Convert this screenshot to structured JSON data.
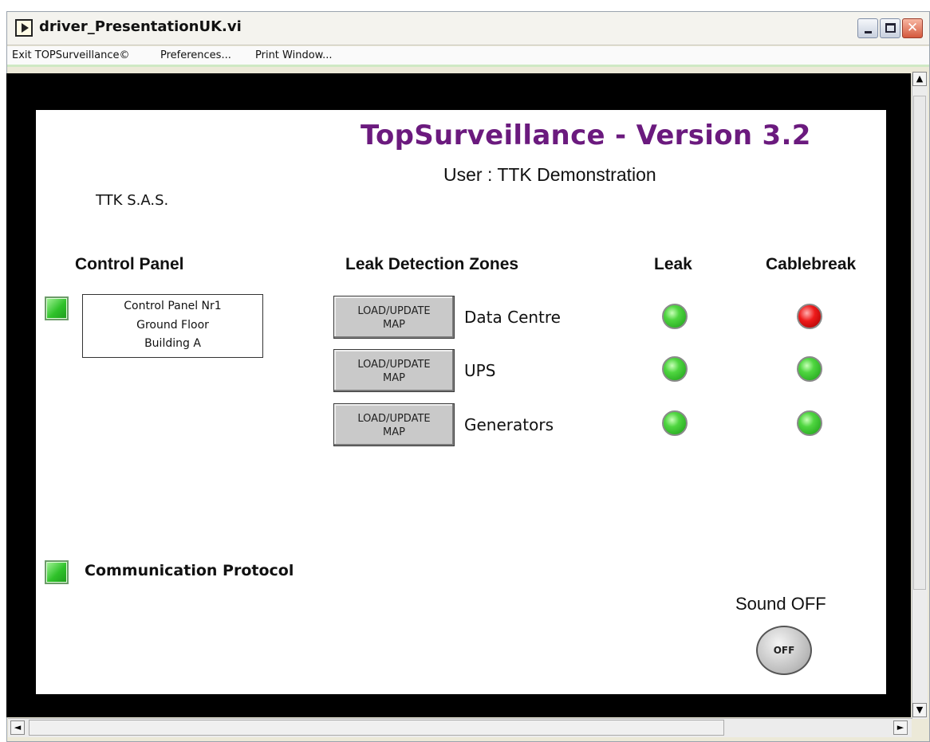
{
  "window": {
    "title": "driver_PresentationUK.vi"
  },
  "menu": {
    "items": [
      {
        "label": "Exit TOPSurveillance©"
      },
      {
        "label": "Preferences..."
      },
      {
        "label": "Print Window..."
      }
    ]
  },
  "panel": {
    "title": "TopSurveillance - Version 3.2",
    "user": "User :  TTK Demonstration",
    "company": "TTK S.A.S."
  },
  "headers": {
    "control_panel": "Control Panel",
    "zones": "Leak Detection Zones",
    "leak": "Leak",
    "cablebreak": "Cablebreak"
  },
  "control_panel": {
    "lines": [
      "Control Panel Nr1",
      "Ground Floor",
      "Building A"
    ],
    "status": "green"
  },
  "zones": [
    {
      "button_line1": "LOAD/UPDATE",
      "button_line2": "MAP",
      "name": "Data Centre",
      "leak": "green",
      "cablebreak": "red"
    },
    {
      "button_line1": "LOAD/UPDATE",
      "button_line2": "MAP",
      "name": "UPS",
      "leak": "green",
      "cablebreak": "green"
    },
    {
      "button_line1": "LOAD/UPDATE",
      "button_line2": "MAP",
      "name": "Generators",
      "leak": "green",
      "cablebreak": "green"
    }
  ],
  "communication": {
    "label": "Communication Protocol",
    "status": "green"
  },
  "sound": {
    "label": "Sound OFF",
    "button": "OFF"
  },
  "scroll": {
    "up": "▲",
    "down": "▼",
    "left": "◄",
    "right": "►"
  }
}
